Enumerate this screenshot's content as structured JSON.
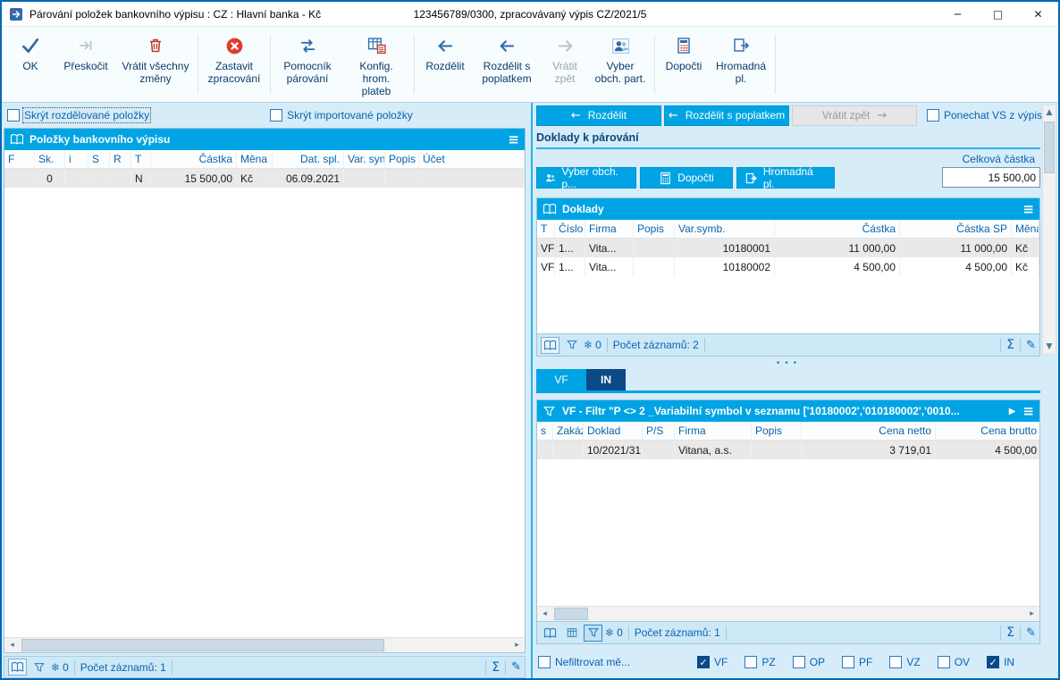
{
  "window": {
    "title": "Párování položek bankovního výpisu : CZ : Hlavní banka - Kč",
    "subtitle": "123456789/0300, zpracovávaný výpis CZ/2021/5"
  },
  "icons": {
    "menu": "≡",
    "sum": "Σ",
    "edit": "✎",
    "snowflake": "❄",
    "arrow_left": "←",
    "arrow_right": "→",
    "play": "▶",
    "scroll_up": "▲",
    "scroll_down": "▼",
    "scroll_left": "◂",
    "scroll_right": "▸",
    "dots": "•••",
    "minimize": "─",
    "maximize": "□",
    "close": "✕"
  },
  "toolbar": {
    "buttons": [
      {
        "label": "OK"
      },
      {
        "label": "Přeskočit"
      },
      {
        "label": "Vrátit všechny změny"
      },
      {
        "label": "Zastavit zpracování"
      },
      {
        "label": "Pomocník párování"
      },
      {
        "label": "Konfig. hrom. plateb"
      },
      {
        "label": "Rozdělit"
      },
      {
        "label": "Rozdělit s poplatkem"
      },
      {
        "label": "Vrátit zpět",
        "disabled": true
      },
      {
        "label": "Vyber obch. part."
      },
      {
        "label": "Dopočti"
      },
      {
        "label": "Hromadná pl."
      }
    ]
  },
  "left": {
    "cb_hide_split": "Skrýt rozdělované položky",
    "cb_hide_imported": "Skrýt importované položky",
    "grid_title": "Položky bankovního výpisu",
    "columns": [
      "F",
      "Sk.",
      "i",
      "S",
      "R",
      "T",
      "Částka",
      "Měna",
      "Dat. spl.",
      "Var. syn",
      "Popis",
      "Účet"
    ],
    "rows": [
      [
        "",
        "0",
        "",
        "",
        "",
        "N",
        "15 500,00",
        "Kč",
        "06.09.2021",
        "",
        "",
        ""
      ]
    ],
    "status": {
      "freeze_count": "0",
      "records": "Počet záznamů: 1"
    }
  },
  "right": {
    "split_label": "Rozdělit",
    "split_fee_label": "Rozdělit s poplatkem",
    "undo_label": "Vrátit zpět",
    "keep_vs_label": "Ponechat VS z výpisu",
    "keep_vs_checked": false,
    "section_title": "Doklady k párování",
    "total_label": "Celková částka",
    "total_value": "15 500,00",
    "small_buttons": [
      "Vyber obch. p...",
      "Dopočti",
      "Hromadná pl."
    ],
    "docs": {
      "title": "Doklady",
      "columns": [
        "T",
        "Číslo",
        "Firma",
        "Popis",
        "Var.symb.",
        "Částka",
        "Částka SP",
        "Měna"
      ],
      "rows": [
        [
          "VF",
          "1...",
          "Vita...",
          "",
          "10180001",
          "11 000,00",
          "11 000,00",
          "Kč"
        ],
        [
          "VF",
          "1...",
          "Vita...",
          "",
          "10180002",
          "4 500,00",
          "4 500,00",
          "Kč"
        ]
      ],
      "status": {
        "freeze_count": "0",
        "records": "Počet záznamů: 2"
      }
    },
    "tabs": [
      {
        "label": "VF",
        "active": false
      },
      {
        "label": "IN",
        "active": true
      }
    ],
    "filter": {
      "title": "VF - Filtr \"P <> 2 _Variabilní symbol v seznamu ['10180002','010180002','0010...",
      "columns": [
        "s",
        "Zakázk:",
        "Doklad",
        "P/S",
        "Firma",
        "Popis",
        "Cena netto",
        "Cena brutto"
      ],
      "rows": [
        [
          "",
          "",
          "10/2021/31",
          "",
          "Vitana, a.s.",
          "",
          "3 719,01",
          "4 500,00"
        ]
      ],
      "status": {
        "freeze_count": "0",
        "records": "Počet záznamů: 1"
      }
    },
    "bottom": {
      "nofilter_label": "Nefiltrovat mě...",
      "nofilter_checked": false,
      "checks": [
        {
          "label": "VF",
          "checked": true
        },
        {
          "label": "PZ",
          "checked": false
        },
        {
          "label": "OP",
          "checked": false
        },
        {
          "label": "PF",
          "checked": false
        },
        {
          "label": "VZ",
          "checked": false
        },
        {
          "label": "OV",
          "checked": false
        },
        {
          "label": "IN",
          "checked": true
        }
      ]
    }
  }
}
